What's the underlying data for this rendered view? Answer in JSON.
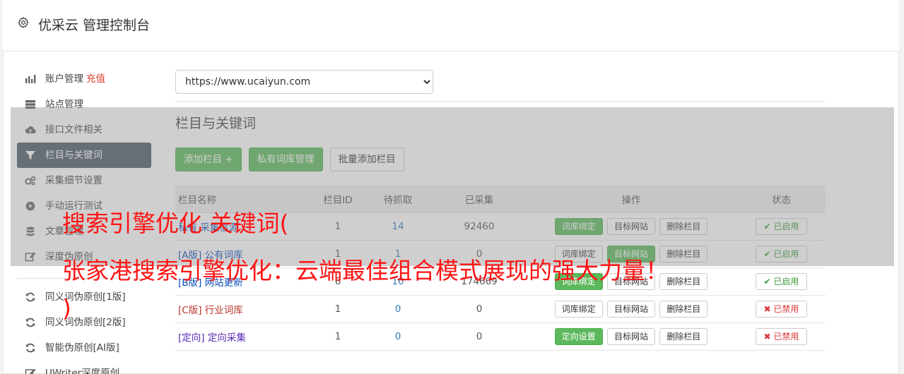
{
  "header": {
    "title": "优采云 管理控制台"
  },
  "sidebar": {
    "items": [
      {
        "label": "账户管理",
        "extra": "充值"
      },
      {
        "label": "站点管理"
      },
      {
        "label": "接口文件相关"
      },
      {
        "label": "栏目与关键词"
      },
      {
        "label": "采集细节设置"
      },
      {
        "label": "手动运行测试"
      },
      {
        "label": "文章管理"
      },
      {
        "label": "深度伪原创"
      }
    ],
    "tools": [
      {
        "label": "同义词伪原创[1版]"
      },
      {
        "label": "同义词伪原创[2版]"
      },
      {
        "label": "智能伪原创[AI版]"
      },
      {
        "label": "UWriter深度原创"
      }
    ]
  },
  "main": {
    "site_select": "https://www.ucaiyun.com",
    "section_title": "栏目与关键词",
    "buttons": {
      "add_column": "添加栏目 +",
      "private_lib": "私有词库管理",
      "batch_add": "批量添加栏目"
    },
    "table": {
      "headers": [
        "栏目名称",
        "栏目ID",
        "待抓取",
        "已采集",
        "操作",
        "状态"
      ],
      "rows": [
        {
          "tag": "",
          "name": "私有 采集信源",
          "id": "1",
          "pending": "14",
          "collected": "92460",
          "op1": "词库绑定",
          "op2": "目标网站",
          "op3": "删除栏目",
          "status": "已启用"
        },
        {
          "tag": "[A版]",
          "name": "公有词库",
          "id": "1",
          "pending": "1",
          "collected": "0",
          "op1": "词库绑定",
          "op2": "目标网站",
          "op3": "删除栏目",
          "status": "已启用"
        },
        {
          "tag": "[B版]",
          "name": "网站更新",
          "id": "6",
          "pending": "10",
          "collected": "174669",
          "op1": "词库绑定",
          "op2": "目标网站",
          "op3": "删除栏目",
          "status": "已启用"
        },
        {
          "tag": "[C版]",
          "name": "行业词库",
          "id": "1",
          "pending": "0",
          "collected": "0",
          "op1": "词库绑定",
          "op2": "目标网站",
          "op3": "删除栏目",
          "status": "已禁用"
        },
        {
          "tag": "[定向]",
          "name": "定向采集",
          "id": "1",
          "pending": "0",
          "collected": "0",
          "op1": "定向设置",
          "op2": "目标网站",
          "op3": "删除栏目",
          "status": "已禁用"
        }
      ]
    }
  },
  "headline": {
    "line1": "搜索引擎优化 关键词(",
    "line2": "张家港搜索引擎优化：云端最佳组合模式展现的强大力量！",
    "line3": ")"
  },
  "colors": {
    "accent_green": "#5cb85c",
    "sidebar_active": "#4a5866",
    "headline_red": "#ff1414",
    "recharge_red": "#e03a2e"
  }
}
